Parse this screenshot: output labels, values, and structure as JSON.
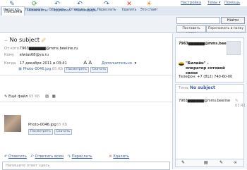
{
  "topbar": {
    "settings": "Настройка",
    "themes": "Темы ▾",
    "help": "Помощь"
  },
  "tabs": [
    "Письма",
    "Контакты",
    "Подписки",
    "Календарь"
  ],
  "toolbar": {
    "buttons": [
      {
        "label": "Написать",
        "icon": "compose-icon",
        "glyph": "✎",
        "color": "#3a6fb5"
      },
      {
        "label": "Проверить",
        "icon": "check-mail-icon",
        "glyph": "⟳",
        "color": "#3a9a3a"
      },
      {
        "label": "Ответить",
        "icon": "reply-icon",
        "glyph": "↶",
        "color": "#2f5fae"
      },
      {
        "label": "Ответить всем",
        "icon": "reply-all-icon",
        "glyph": "↶",
        "color": "#2f5fae"
      },
      {
        "label": "Переслать",
        "icon": "forward-icon",
        "glyph": "↷",
        "color": "#2f5fae"
      },
      {
        "label": "Удалить",
        "icon": "delete-icon",
        "glyph": "✕",
        "color": "#d23b2b"
      },
      {
        "label": "Это спам!",
        "icon": "spam-icon",
        "glyph": "☀",
        "color": "#e08a14"
      }
    ],
    "search_placeholder": "",
    "find_label": "Найти",
    "filter_label": "Поставить метку",
    "move_label": "Переложить в папку"
  },
  "message": {
    "subject": "No subject",
    "from_label": "От кого",
    "from_value": "7963▆▆▆▆▆▆@mms.beeline.ru",
    "to_label": "Кому",
    "to_value": "elwias68@ya.ru",
    "date_label": "Когда",
    "date_value": "17 декабря 2011 в 03:41",
    "font_size": "A A",
    "more": "Дополнительно",
    "attachment_name": "Photo-0046.jpg",
    "attachment_size": "65 КБ",
    "view_label": "Посмотреть",
    "download_label": "Скачать",
    "all_files": "Ещё файл",
    "all_files_size": "65 КБ",
    "photo_name": "Photo-0046.jpg",
    "photo_size": "65 КБ",
    "photo_view": "Посмотреть",
    "photo_download": "Скачать"
  },
  "actions": {
    "reply": "Ответить",
    "reply_all": "Ответить всем",
    "forward": "Переслать",
    "delete": "Удалить"
  },
  "reply_placeholder": "Напишите ответ здесь",
  "contact": {
    "address": "7963▆▆▆▆▆▆@mms.beel",
    "operator": "\"Билайн\" - оператор сотовой связи",
    "phone": "Телефон: +7 (812) 740-60-00"
  },
  "thread": {
    "header_label": "Тема:",
    "subject": "No subject",
    "sender": "7963▆▆▆▆▆▆@mms.beeline",
    "time": "03:41"
  },
  "colors": {
    "accent": "#3a5f92",
    "tabbar": "#dfe7f1",
    "toolbar": "#eef2f7"
  }
}
